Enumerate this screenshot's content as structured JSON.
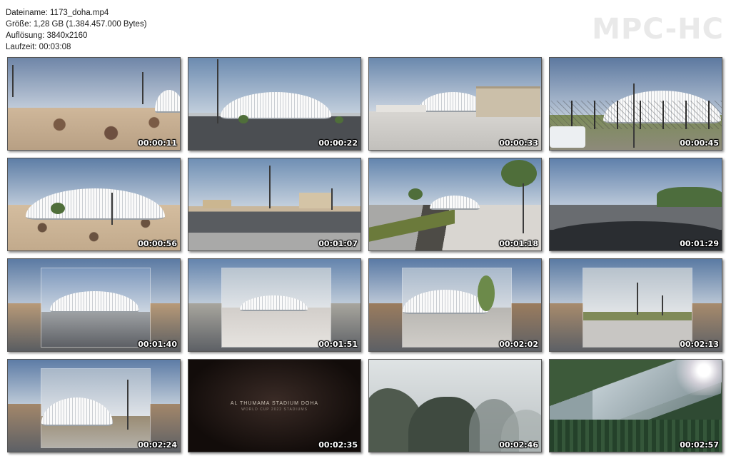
{
  "file_info": {
    "name_line": "Dateiname: 1173_doha.mp4",
    "size_line": "Größe: 1,28 GB (1.384.457.000 Bytes)",
    "resolution_line": "Auflösung: 3840x2160",
    "duration_line": "Laufzeit: 00:03:08"
  },
  "logo": "MPC-HC",
  "thumbnails": [
    {
      "timestamp": "00:00:11",
      "scene": "desert-dunes"
    },
    {
      "timestamp": "00:00:22",
      "scene": "stadium-road"
    },
    {
      "timestamp": "00:00:33",
      "scene": "stadium-plaza"
    },
    {
      "timestamp": "00:00:45",
      "scene": "stadium-fence"
    },
    {
      "timestamp": "00:00:56",
      "scene": "stadium-desert"
    },
    {
      "timestamp": "00:01:07",
      "scene": "city-road"
    },
    {
      "timestamp": "00:01:18",
      "scene": "walkway"
    },
    {
      "timestamp": "00:01:29",
      "scene": "dashcam-road"
    },
    {
      "timestamp": "00:01:40",
      "scene": "inset-stadium"
    },
    {
      "timestamp": "00:01:51",
      "scene": "inset-stadium-plaza"
    },
    {
      "timestamp": "00:02:02",
      "scene": "inset-stadium-tree"
    },
    {
      "timestamp": "00:02:13",
      "scene": "inset-parking"
    },
    {
      "timestamp": "00:02:24",
      "scene": "inset-stadium-lamps"
    },
    {
      "timestamp": "00:02:35",
      "scene": "title-card"
    },
    {
      "timestamp": "00:02:46",
      "scene": "misty-mountains"
    },
    {
      "timestamp": "00:02:57",
      "scene": "forest-mountains"
    }
  ],
  "title_card": {
    "title": "AL THUMAMA STADIUM DOHA",
    "subtitle": "WORLD CUP 2022 STADIUMS"
  }
}
